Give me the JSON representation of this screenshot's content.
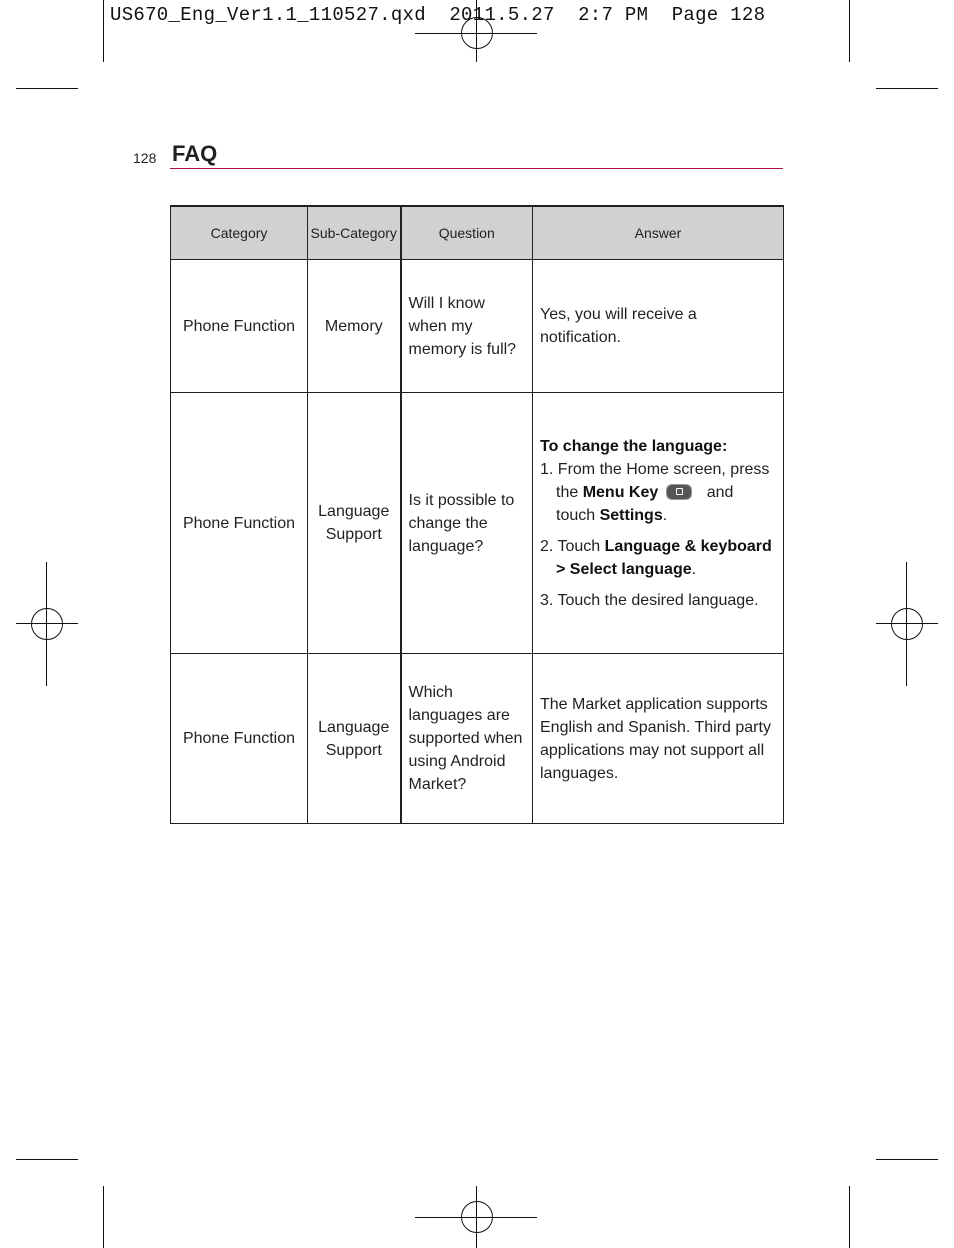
{
  "slug": "US670_Eng_Ver1.1_110527.qxd  2011.5.27  2:7 PM  Page 128",
  "page_number": "128",
  "section_title": "FAQ",
  "table": {
    "headers": [
      "Category",
      "Sub-Category",
      "Question",
      "Answer"
    ],
    "rows": [
      {
        "category": "Phone Function",
        "subcategory": "Memory",
        "question": "Will I know when my memory is full?",
        "answer": "Yes, you will receive a notification."
      },
      {
        "category": "Phone Function",
        "subcategory": "Language Support",
        "question": "Is it possible to change the language?",
        "answer": {
          "intro": "To change the language:",
          "step1_a": "1. From the Home screen, press the ",
          "step1_menu": "Menu Key",
          "step1_b": " and touch ",
          "step1_settings": "Settings",
          "step1_c": ".",
          "step2_a": "2. Touch ",
          "step2_b": "Language & keyboard > Select language",
          "step2_c": ".",
          "step3": "3. Touch the desired language."
        }
      },
      {
        "category": "Phone Function",
        "subcategory": "Language Support",
        "question": "Which languages are supported when using Android Market?",
        "answer": "The Market application supports English and Spanish. Third party applications may not support all languages."
      }
    ]
  },
  "colors": {
    "accent_rule": "#b0124e",
    "header_bg": "#d1d1d1"
  }
}
